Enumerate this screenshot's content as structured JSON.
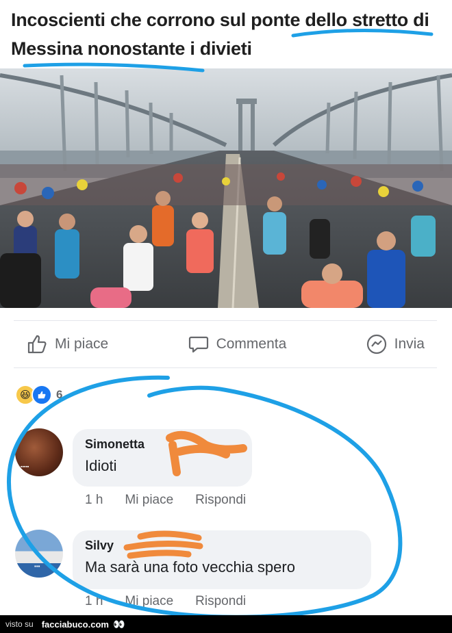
{
  "headline": "Incoscienti che corrono sul ponte dello stretto di Messina nonostante i divieti",
  "photo": {
    "icon": "marathon-photo",
    "watermark": ""
  },
  "actions": {
    "like_label": "Mi piace",
    "comment_label": "Commenta",
    "share_label": "Invia"
  },
  "reactions": {
    "count": "6"
  },
  "comments": [
    {
      "author": "Simonetta",
      "text": "Idioti",
      "time": "1 h",
      "like": "Mi piace",
      "reply": "Rispondi"
    },
    {
      "author": "Silvy",
      "text": "Ma sarà una foto vecchia spero",
      "time": "1 h",
      "like": "Mi piace",
      "reply": "Rispondi"
    }
  ],
  "footer": {
    "prefix": "visto su",
    "site": "facciabuco.com",
    "eyes": "👀"
  },
  "colors": {
    "annotation_blue": "#1ea0e6",
    "scribble_orange": "#f08a3c",
    "facebook_blue": "#1877f2"
  }
}
